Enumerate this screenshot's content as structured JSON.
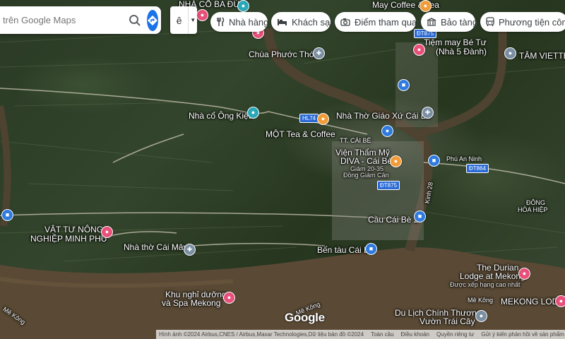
{
  "search": {
    "placeholder": "trên Google Maps"
  },
  "language": {
    "glyph": "ê"
  },
  "chips": [
    {
      "label": "Nhà hàng",
      "icon": "restaurant-icon"
    },
    {
      "label": "Khách sạn",
      "icon": "hotel-icon"
    },
    {
      "label": "Điểm tham quan",
      "icon": "camera-icon"
    },
    {
      "label": "Bảo tàng",
      "icon": "museum-icon"
    },
    {
      "label": "Phương tiện công cộ",
      "icon": "transit-icon"
    }
  ],
  "places": {
    "nha_co_ba_duc": "NHÀ CỔ BA ĐỨC",
    "may_coffee": "May Coffee & Tea",
    "chua_phuoc_thoi": "Chùa Phước Thới",
    "tiem_may_line1": "Tiệm may Bé Tư",
    "tiem_may_line2": "(Nhà 5 Đành)",
    "tam_viettel": "TÂM VIETTEL",
    "nha_co_ong_kiet": "Nhà cổ Ông Kiệt",
    "nha_tho_giao_xu": "Nhà Thờ Giáo Xứ Cái Bè",
    "mot_tea": "MỘT Tea & Coffee",
    "tt_cai_be": "TT. CÁI BÈ",
    "vien_tham_my_line1": "Viện Thẩm Mỹ",
    "vien_tham_my_line2": "DIVA - Cái Bè",
    "giam_can_line1": "Giảm 20-35",
    "giam_can_line2": "Đồng Giảm Cân",
    "phu_an_ninh": "Phú An Ninh",
    "dong_hoa_hiep_line1": "ĐÔNG",
    "dong_hoa_hiep_line2": "HÒA HIỆP",
    "vat_tu_line1": "VẬT TƯ NÔNG",
    "vat_tu_line2": "NGHIỆP MINH PHÚ",
    "nha_tho_cai_may": "Nhà thờ Cái Mây",
    "cau_cai_be_2": "Cầu Cái Bè 2",
    "ben_tau": "Bến tàu Cái Bè",
    "durian_line1": "The Durian",
    "durian_line2": "Lodge at Mekong",
    "durian_line3": "Được xếp hạng cao nhất",
    "me_kong_right": "Mê Kông",
    "mekong_lodge": "MEKONG LODGE",
    "khu_nghi_line1": "Khu nghỉ dưỡng",
    "khu_nghi_line2": "và Spa Mekong",
    "du_lich_line1": "Du Lịch Chính Thương",
    "du_lich_line2": "Vườn Trái Cây",
    "me_kong_left": "Mê Kông",
    "me_kong_center": "Mê Kông",
    "kinh_28": "Kinh 28"
  },
  "road_shields": {
    "dt875_top": "ĐT875",
    "hl74": "HL74",
    "dt864": "ĐT864",
    "dt875_mid": "ĐT875"
  },
  "brand": "Google",
  "footer": {
    "imagery": "Hình ảnh ©2024 Airbus,CNES / Airbus,Maxar Technologies,Dữ liệu bản đồ ©2024",
    "global": "Toàn cầu",
    "terms": "Điều khoản",
    "privacy": "Quyền riêng tư",
    "feedback": "Gửi ý kiến phản hồi về sản phẩm"
  },
  "colors": {
    "river": "#5a4a35",
    "accent": "#1a73e8"
  }
}
